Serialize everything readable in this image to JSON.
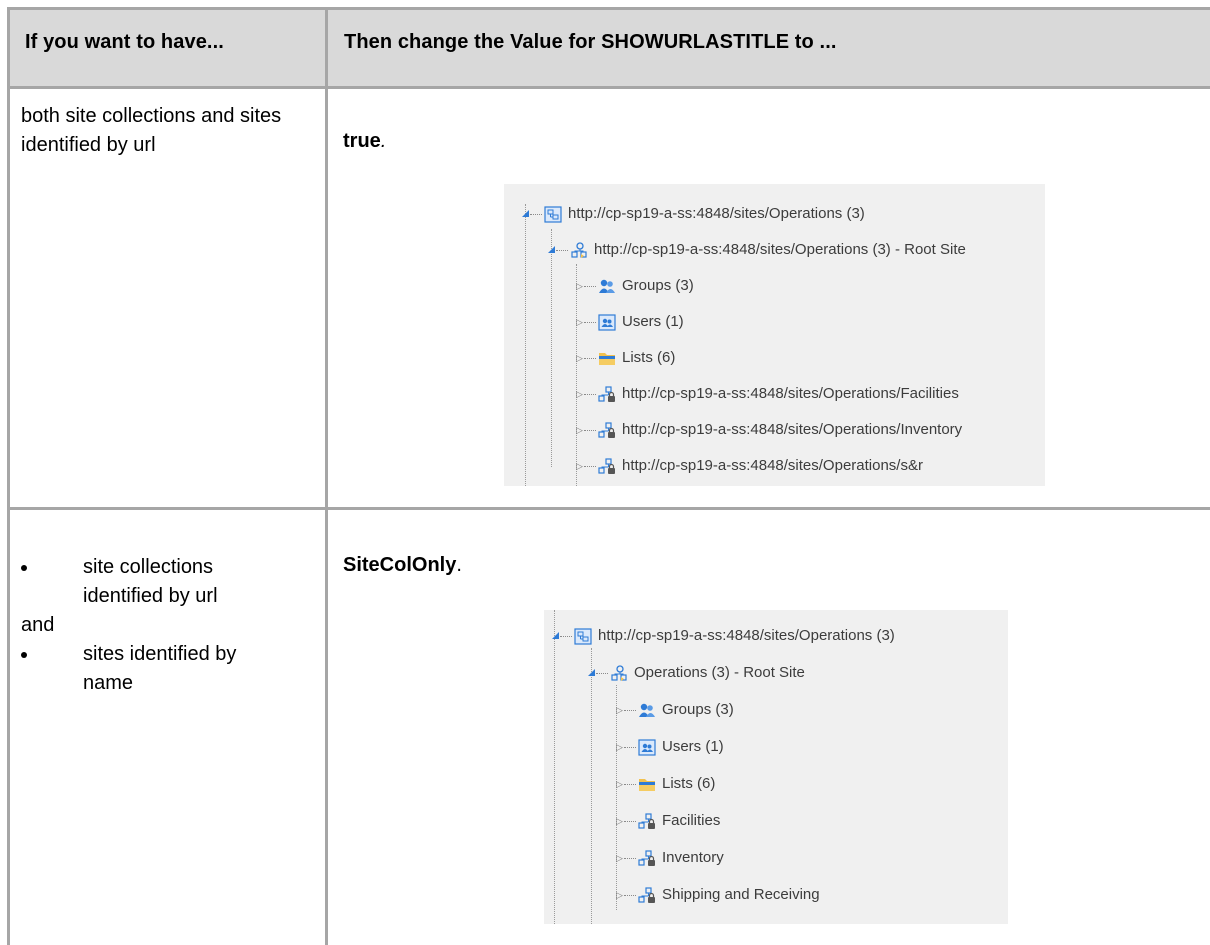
{
  "table": {
    "header": {
      "col1": "If you want to have...",
      "col2": "Then change the Value for SHOWURLASTITLE to ..."
    },
    "rows": [
      {
        "condition_text": "both site collections and sites identified by url",
        "value_bold": "true",
        "value_suffix": ".",
        "tree": [
          {
            "label": "http://cp-sp19-a-ss:4848/sites/Operations (3)",
            "icon": "site-collection-icon"
          },
          {
            "label": "http://cp-sp19-a-ss:4848/sites/Operations (3) - Root Site",
            "icon": "root-site-icon"
          },
          {
            "label": "Groups (3)",
            "icon": "groups-icon"
          },
          {
            "label": "Users (1)",
            "icon": "users-icon"
          },
          {
            "label": "Lists (6)",
            "icon": "lists-folder-icon"
          },
          {
            "label": "http://cp-sp19-a-ss:4848/sites/Operations/Facilities",
            "icon": "subsite-icon"
          },
          {
            "label": "http://cp-sp19-a-ss:4848/sites/Operations/Inventory",
            "icon": "subsite-icon"
          },
          {
            "label": "http://cp-sp19-a-ss:4848/sites/Operations/s&r",
            "icon": "subsite-icon"
          }
        ]
      },
      {
        "bullet1": "site collections identified by url",
        "and_text": "and",
        "bullet2": "sites identified by name",
        "value_bold": "SiteColOnly",
        "value_suffix": ".",
        "tree": [
          {
            "label": "http://cp-sp19-a-ss:4848/sites/Operations (3)",
            "icon": "site-collection-icon"
          },
          {
            "label": "Operations (3) - Root Site",
            "icon": "root-site-icon"
          },
          {
            "label": "Groups (3)",
            "icon": "groups-icon"
          },
          {
            "label": "Users (1)",
            "icon": "users-icon"
          },
          {
            "label": "Lists (6)",
            "icon": "lists-folder-icon"
          },
          {
            "label": "Facilities",
            "icon": "subsite-icon"
          },
          {
            "label": "Inventory",
            "icon": "subsite-icon"
          },
          {
            "label": "Shipping and Receiving",
            "icon": "subsite-icon"
          }
        ]
      }
    ]
  },
  "colors": {
    "header_bg": "#d9d9d9",
    "grid": "#a6a6a6",
    "panel_bg": "#f0f0f0",
    "icon_blue": "#2e7bd6",
    "folder_yellow": "#f2c14e"
  }
}
